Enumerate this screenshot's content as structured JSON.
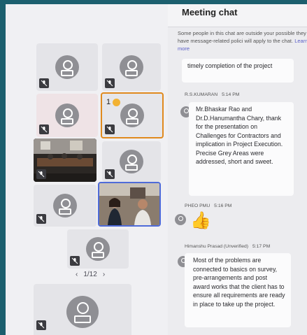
{
  "gallery": {
    "pager": {
      "prev": "‹",
      "label": "1/12",
      "next": "›"
    },
    "raised_hand_count": "1"
  },
  "chat": {
    "title": "Meeting chat",
    "notice": "Some people in this chat are outside your possible they have message-related polici will apply to the chat.",
    "notice_link": "Learn more",
    "messages": [
      {
        "sender": "",
        "time": "",
        "text": "timely completion of the project"
      },
      {
        "sender": "R.S.KUMARAN",
        "time": "5:14 PM",
        "text": "Mr.Bhaskar Rao and Dr.D.Hanumantha Chary, thank for the presentation on Challenges for Contractors and implication in Project Execution. Precise Grey Areas were addressed, short and sweet."
      },
      {
        "sender": "PHEO PMU",
        "time": "5:16 PM",
        "text": "👍"
      },
      {
        "sender": "Himanshu Prasad (Unverified)",
        "time": "5:17 PM",
        "text": "Most of the problems are connected to basics on survey, pre-arrangements and post award works that the client has to ensure all requirements are ready in place to take up the project."
      }
    ]
  },
  "colors": {
    "speaking_border": "#e08a1e",
    "video_selected_border": "#4f6bd8",
    "link": "#5b5fc7"
  }
}
